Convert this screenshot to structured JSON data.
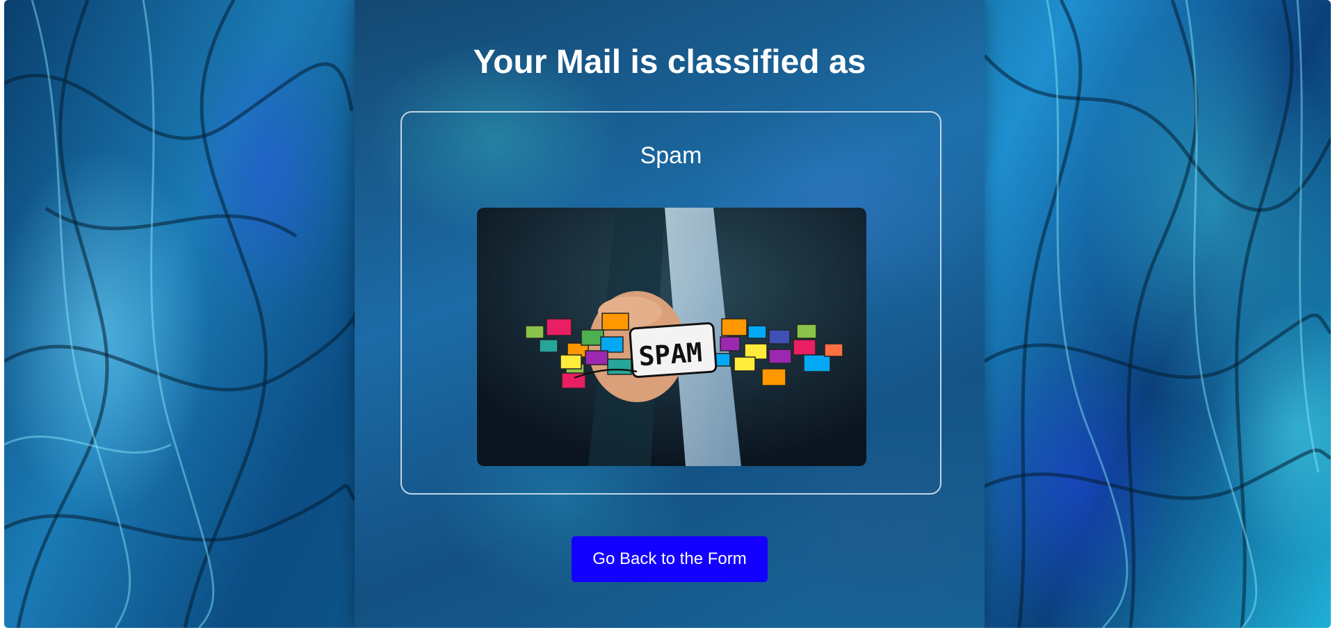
{
  "page": {
    "title": "Your Mail is classified as"
  },
  "result": {
    "label": "Spam",
    "image": {
      "icon": "spam-envelopes-illustration",
      "badge_text": "SPAM"
    }
  },
  "actions": {
    "back_label": "Go Back to the Form"
  },
  "colors": {
    "button": "#1400ff",
    "text": "#ffffff",
    "box_border": "#e1ebf5"
  }
}
